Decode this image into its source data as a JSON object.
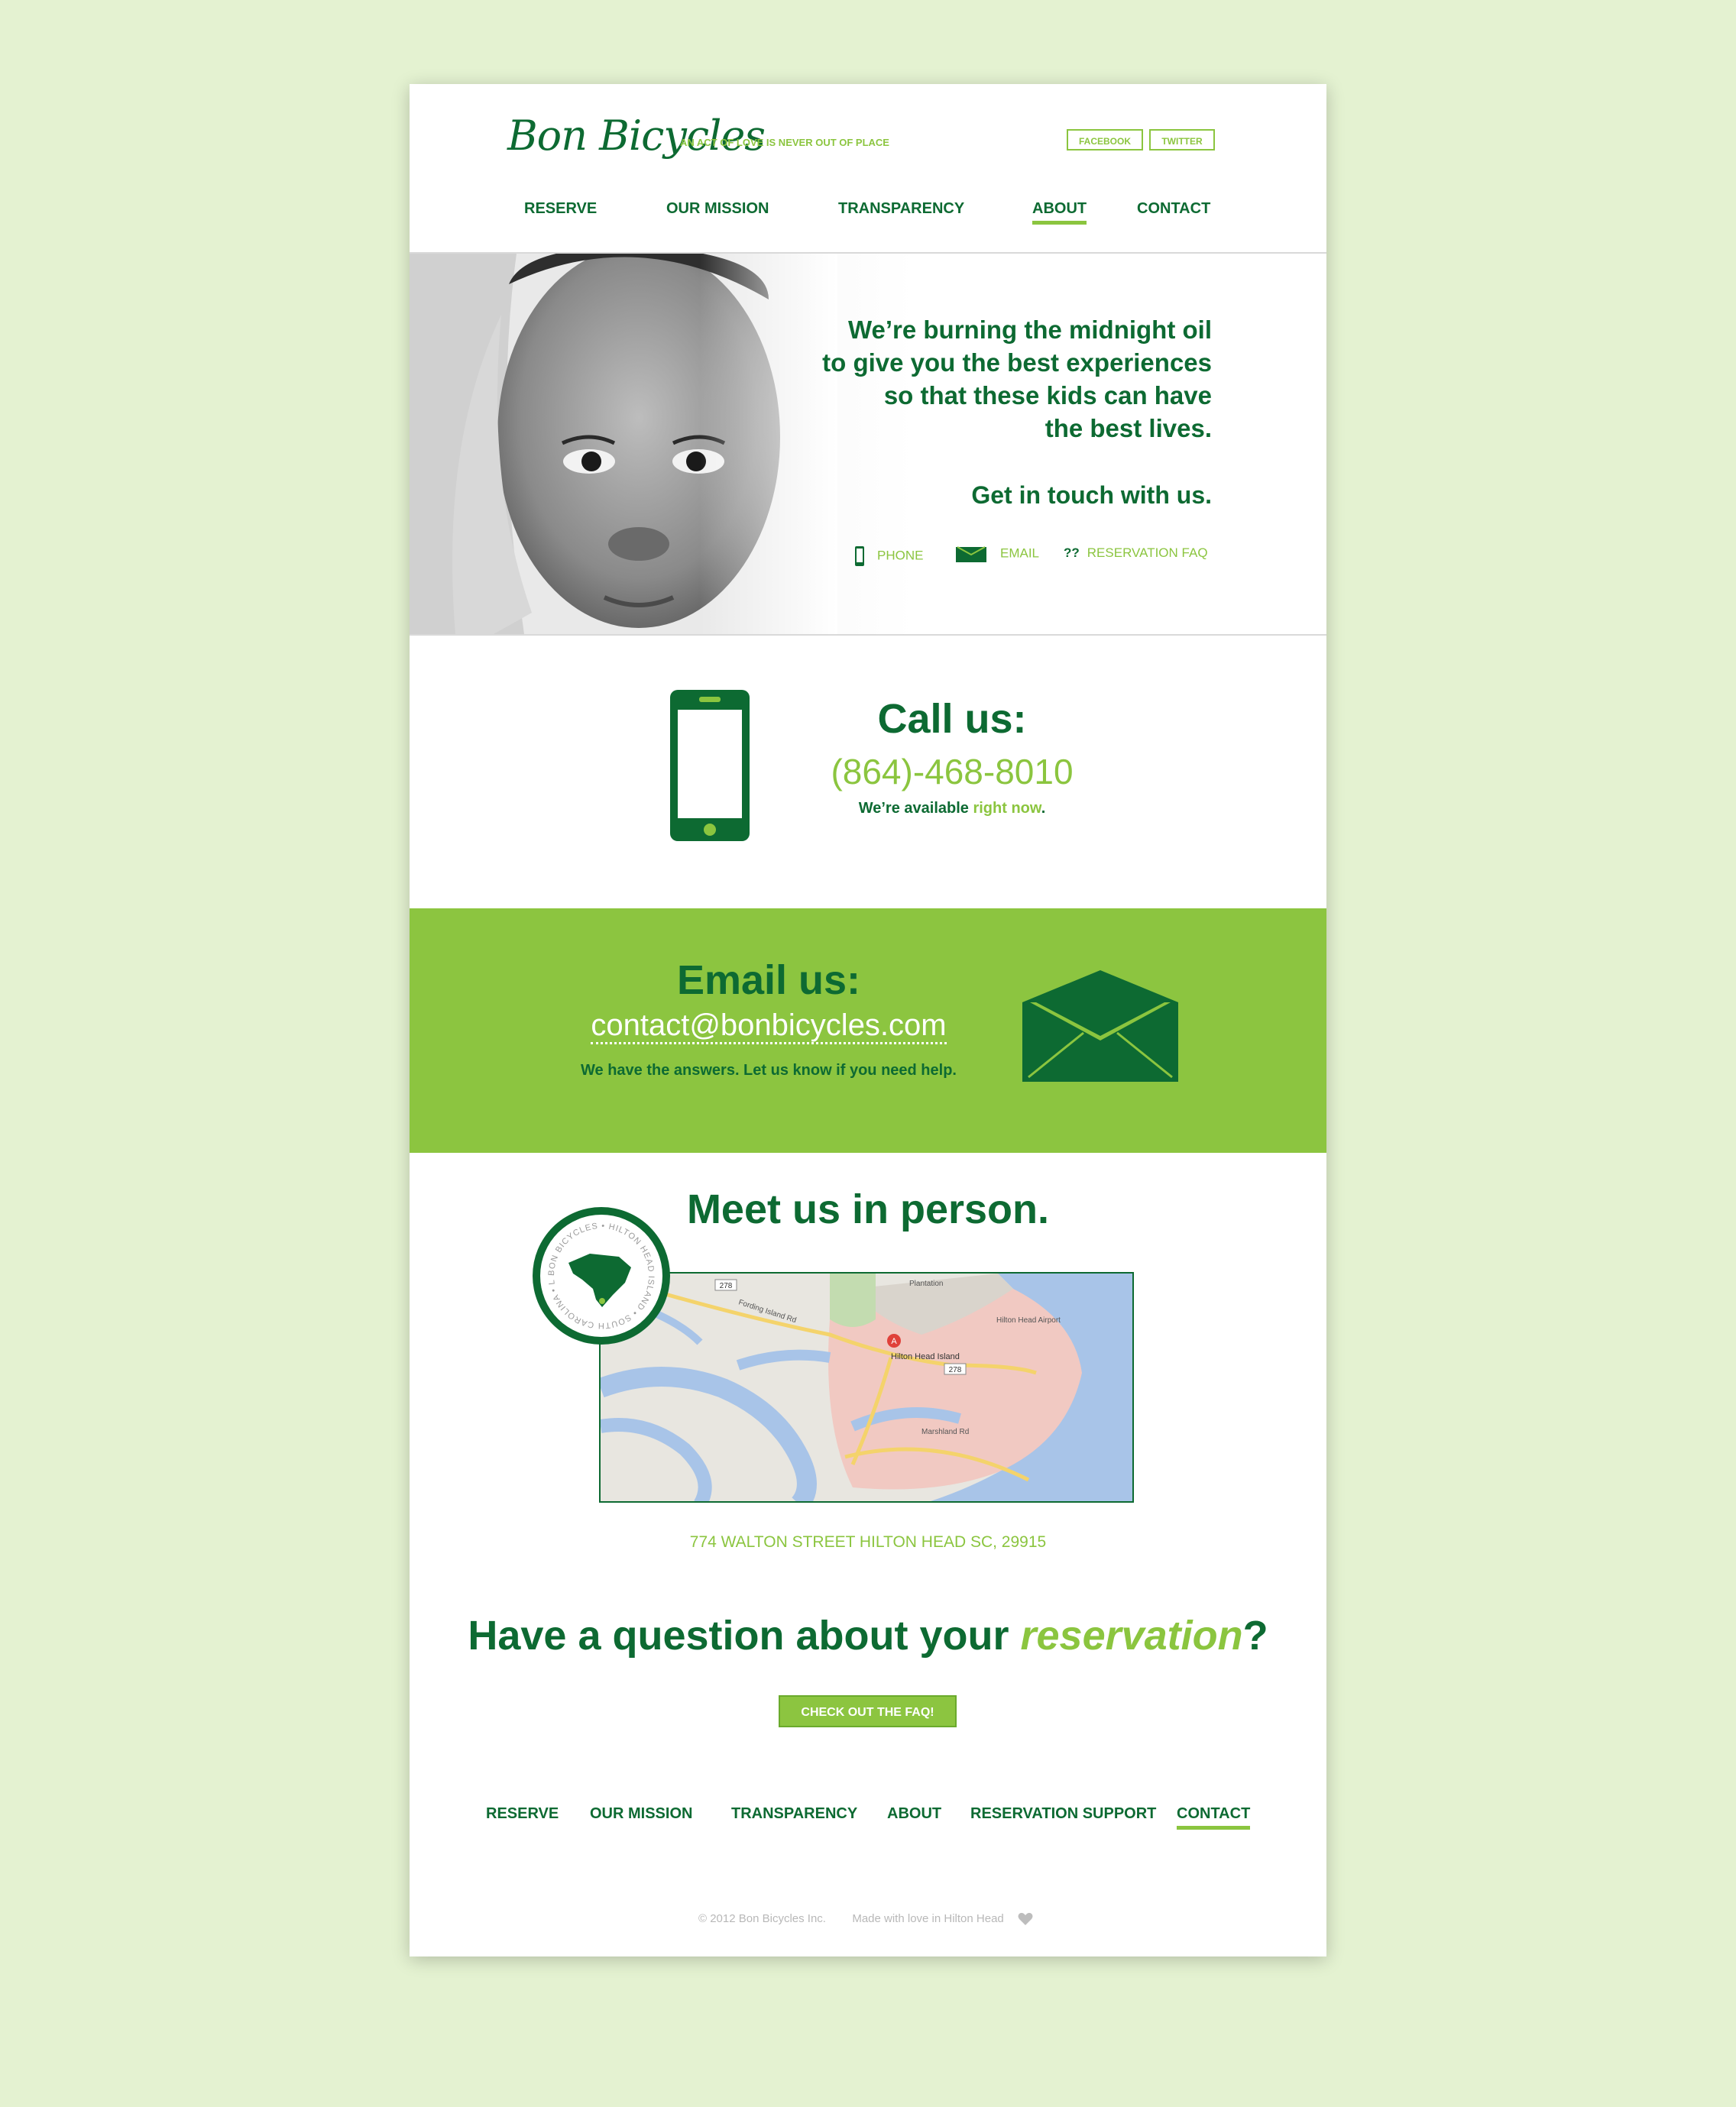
{
  "header": {
    "logo": "Bon Bicycles",
    "tagline": "AN ACT OF LOVE IS NEVER OUT OF PLACE",
    "social": [
      "FACEBOOK",
      "TWITTER"
    ]
  },
  "nav": {
    "items": [
      "RESERVE",
      "OUR MISSION",
      "TRANSPARENCY",
      "ABOUT",
      "CONTACT"
    ],
    "active": "ABOUT"
  },
  "hero": {
    "lines": [
      "We’re burning the midnight oil",
      "to give you the best experiences",
      "so that these kids can have",
      "the best lives."
    ],
    "cta": "Get in touch with us.",
    "links": [
      {
        "icon": "phone-icon",
        "label": "PHONE"
      },
      {
        "icon": "envelope-icon",
        "label": "EMAIL"
      },
      {
        "icon": "question-icon",
        "label": "RESERVATION FAQ"
      }
    ]
  },
  "call": {
    "title": "Call us:",
    "phone": "(864)-468-8010",
    "avail_pre": "We’re available ",
    "avail_link": "right now",
    "avail_post": "."
  },
  "email": {
    "title": "Email us:",
    "address": "contact@bonbicycles.com",
    "sub": "We have the answers. Let us know if you need help."
  },
  "meet": {
    "title": "Meet us in person.",
    "badge_text": "BON BICYCLES • HILTON HEAD ISLAND • SOUTH CAROLINA • LOVE •",
    "map_labels": {
      "place": "Hilton Head Island",
      "airport": "Hilton Head Airport",
      "plantation": "Plantation",
      "road1": "Fording Island Rd",
      "road2": "Marshland Rd",
      "route1": "278",
      "route2": "278",
      "pin": "A"
    },
    "address": "774 WALTON STREET HILTON HEAD SC, 29915"
  },
  "question": {
    "pre": "Have a question about your ",
    "em": "reservation",
    "post": "?",
    "button": "CHECK OUT THE FAQ!"
  },
  "footer_nav": {
    "items": [
      "RESERVE",
      "OUR MISSION",
      "TRANSPARENCY",
      "ABOUT",
      "RESERVATION SUPPORT",
      "CONTACT"
    ],
    "active": "CONTACT"
  },
  "footer": {
    "copyright": "© 2012 Bon Bicycles Inc.",
    "made": "Made with love in Hilton Head"
  },
  "colors": {
    "dark_green": "#0d6a32",
    "light_green": "#8bc53f",
    "background": "#e4f2d1"
  }
}
